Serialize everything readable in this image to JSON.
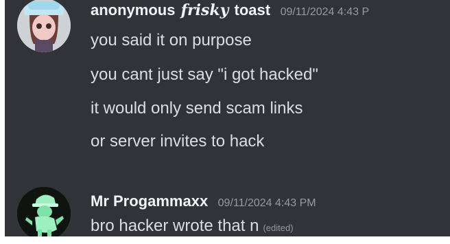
{
  "messages": [
    {
      "author": {
        "name_part1": "anonymous",
        "name_fancy": "frisky",
        "name_part2": "toast"
      },
      "timestamp": "09/11/2024 4:43 P",
      "lines": [
        "you said it on purpose",
        "you cant just say \"i got hacked\"",
        "it would only send scam links",
        "or server invites to hack"
      ]
    },
    {
      "author": {
        "name": "Mr Progammaxx"
      },
      "timestamp": "09/11/2024 4:43 PM",
      "lines": [
        "bro hacker wrote that n"
      ],
      "edited_label": "(edited)"
    }
  ],
  "colors": {
    "background": "#313338",
    "username": "#f2f3f5",
    "message_text": "#dbdee1",
    "timestamp": "#949ba4",
    "avatar2_accent": "#9ff0c0"
  }
}
